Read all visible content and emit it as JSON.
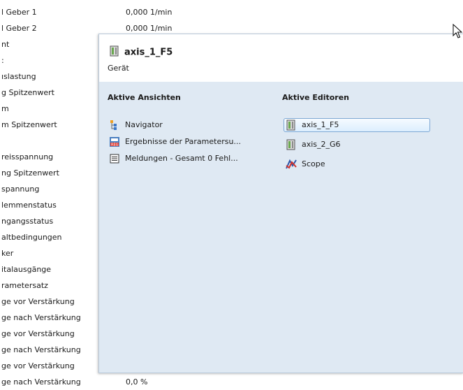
{
  "background_list": {
    "rows": [
      {
        "label": "l Geber 1",
        "value": "0,000 1/min"
      },
      {
        "label": "l Geber 2",
        "value": "0,000 1/min"
      },
      {
        "label": "nt"
      },
      {
        "label": ":"
      },
      {
        "label": "ıslastung"
      },
      {
        "label": "g Spitzenwert"
      },
      {
        "label": "m"
      },
      {
        "label": "m Spitzenwert"
      },
      {
        "label": ""
      },
      {
        "label": "reisspannung"
      },
      {
        "label": "ng Spitzenwert"
      },
      {
        "label": "spannung"
      },
      {
        "label": "lemmenstatus"
      },
      {
        "label": "ngangsstatus"
      },
      {
        "label": "altbedingungen"
      },
      {
        "label": "ker"
      },
      {
        "label": "italausgänge"
      },
      {
        "label": "rametersatz"
      },
      {
        "label": "ge vor Verstärkung"
      },
      {
        "label": "ge nach Verstärkung"
      },
      {
        "label": "ge vor Verstärkung"
      },
      {
        "label": "ge nach Verstärkung"
      },
      {
        "label": "ge vor Verstärkung"
      },
      {
        "label": "ge nach Verstärkung",
        "value": "0,0 %"
      }
    ]
  },
  "popup": {
    "title": "axis_1_F5",
    "subtitle": "Gerät",
    "views_header": "Aktive Ansichten",
    "editors_header": "Aktive Editoren",
    "views": [
      {
        "label": "Navigator",
        "icon": "navigator-icon"
      },
      {
        "label": "Ergebnisse der Parametersu...",
        "icon": "results-icon"
      },
      {
        "label": "Meldungen - Gesamt 0 Fehl...",
        "icon": "messages-icon"
      }
    ],
    "editors": [
      {
        "label": "axis_1_F5",
        "icon": "device-icon",
        "selected": true
      },
      {
        "label": "axis_2_G6",
        "icon": "device-icon",
        "selected": false
      },
      {
        "label": "Scope",
        "icon": "scope-icon",
        "selected": false
      }
    ]
  },
  "colors": {
    "popup_bg": "#dfe9f3",
    "selection_border": "#7ea8d4"
  }
}
